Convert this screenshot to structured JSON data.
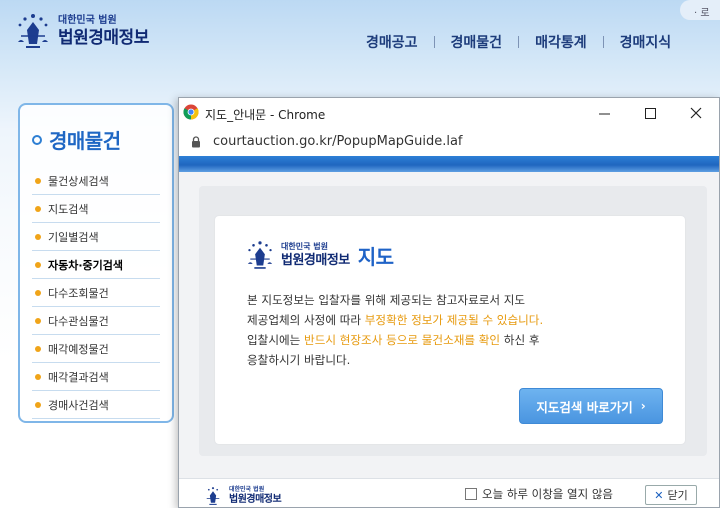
{
  "site": {
    "logo_small": "대한민국 법원",
    "logo_big": "법원경매정보",
    "top_right_text": "· 로",
    "gnb": [
      "경매공고",
      "경매물건",
      "매각통계",
      "경매지식"
    ]
  },
  "left_menu": {
    "title": "경매물건",
    "items": [
      {
        "label": "물건상세검색"
      },
      {
        "label": "지도검색"
      },
      {
        "label": "기일별검색"
      },
      {
        "label": "자동차·중기검색"
      },
      {
        "label": "다수조회물건"
      },
      {
        "label": "다수관심물건"
      },
      {
        "label": "매각예정물건"
      },
      {
        "label": "매각결과검색"
      },
      {
        "label": "경매사건검색"
      }
    ],
    "active_index": 3
  },
  "popup": {
    "window_title": "지도_안내문 - Chrome",
    "url": "courtauction.go.kr/PopupMapGuide.laf",
    "card": {
      "logo_small": "대한민국 법원",
      "logo_big": "법원경매정보",
      "heading": "지도",
      "line1": "본 지도정보는 입찰자를 위해 제공되는 참고자료로서 지도",
      "line2_prefix": "제공업체의 사정에 따라 ",
      "line2_highlight": "부정확한 정보가 제공될 수 있습니다.",
      "line3_prefix": "입찰시에는 ",
      "line3_highlight": "반드시 현장조사 등으로 물건소재를 확인",
      "line3_suffix": " 하신 후",
      "line4": "응찰하시기 바랍니다.",
      "button_label": "지도검색 바로가기",
      "button_arrow": "›"
    },
    "footer": {
      "logo_small": "대한민국 법원",
      "logo_big": "법원경매정보",
      "checkbox_label": "오늘 하루 이창을 열지 않음",
      "close_label": "닫기",
      "close_icon": "✕"
    }
  },
  "colors": {
    "accent_blue": "#1f67c4",
    "highlight_orange": "#e79a0e",
    "button_blue": "#4a95e0"
  }
}
